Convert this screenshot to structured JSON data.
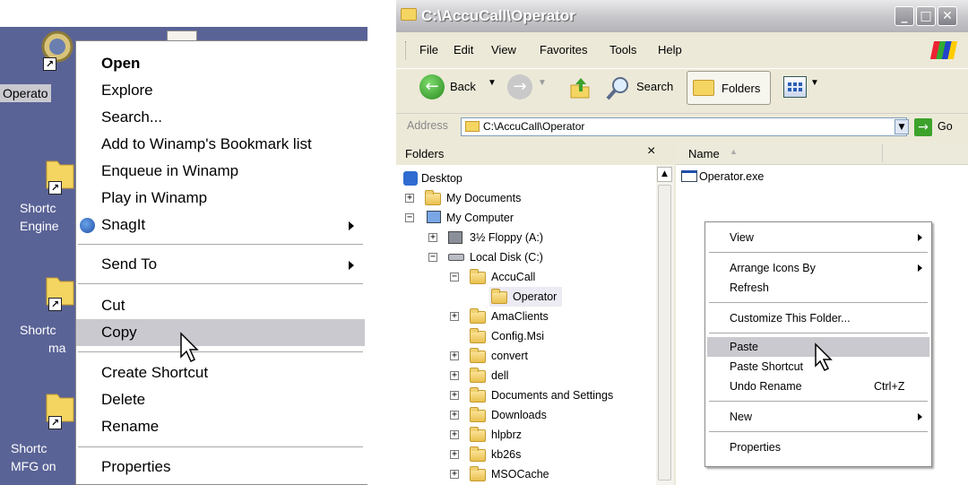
{
  "desktop": {
    "icons": [
      {
        "label": "Operato",
        "icon": "operator-app-icon"
      },
      {
        "label_lines": [
          "Shortc",
          "Engine"
        ],
        "icon": "folder-shortcut-icon"
      },
      {
        "label_lines": [
          "Shortc",
          "ma"
        ],
        "icon": "folder-shortcut-icon"
      },
      {
        "label_lines": [
          "Shortc",
          "MFG on"
        ],
        "icon": "folder-shortcut-icon"
      }
    ],
    "context_menu": {
      "items": [
        {
          "label": "Open",
          "bold": true
        },
        {
          "label": "Explore"
        },
        {
          "label": "Search..."
        },
        {
          "label": "Add to Winamp's Bookmark list"
        },
        {
          "label": "Enqueue in Winamp"
        },
        {
          "label": "Play in Winamp"
        },
        {
          "label": "SnagIt",
          "submenu": true,
          "icon": "snagit-icon"
        },
        {
          "label": "Send To",
          "submenu": true
        },
        {
          "label": "Cut"
        },
        {
          "label": "Copy",
          "highlighted": true
        },
        {
          "label": "Create Shortcut"
        },
        {
          "label": "Delete"
        },
        {
          "label": "Rename"
        },
        {
          "label": "Properties"
        }
      ]
    }
  },
  "window": {
    "title": "C:\\AccuCall\\Operator",
    "menu": [
      "File",
      "Edit",
      "View",
      "Favorites",
      "Tools",
      "Help"
    ],
    "toolbar": {
      "back": "Back",
      "search": "Search",
      "folders": "Folders"
    },
    "address": {
      "label": "Address",
      "value": "C:\\AccuCall\\Operator",
      "go": "Go"
    },
    "folders_panel": {
      "title": "Folders",
      "close": "×",
      "tree": [
        "Desktop",
        "My Documents",
        "My Computer",
        "3½ Floppy (A:)",
        "Local Disk (C:)",
        "AccuCall",
        "Operator",
        "AmaClients",
        "Config.Msi",
        "convert",
        "dell",
        "Documents and Settings",
        "Downloads",
        "hlpbrz",
        "kb26s",
        "MSOCache"
      ]
    },
    "file_list": {
      "column_name": "Name",
      "files": [
        {
          "name": "Operator.exe"
        }
      ]
    },
    "context_menu": {
      "items": [
        {
          "label": "View",
          "submenu": true
        },
        {
          "label": "Arrange Icons By",
          "submenu": true
        },
        {
          "label": "Refresh"
        },
        {
          "label": "Customize This Folder..."
        },
        {
          "label": "Paste",
          "highlighted": true
        },
        {
          "label": "Paste Shortcut"
        },
        {
          "label": "Undo Rename",
          "shortcut": "Ctrl+Z"
        },
        {
          "label": "New",
          "submenu": true
        },
        {
          "label": "Properties"
        }
      ]
    }
  },
  "colors": {
    "desktop": "#5a6396",
    "menu_highlight": "#c9c9cf",
    "xp_face": "#ece9d8"
  }
}
